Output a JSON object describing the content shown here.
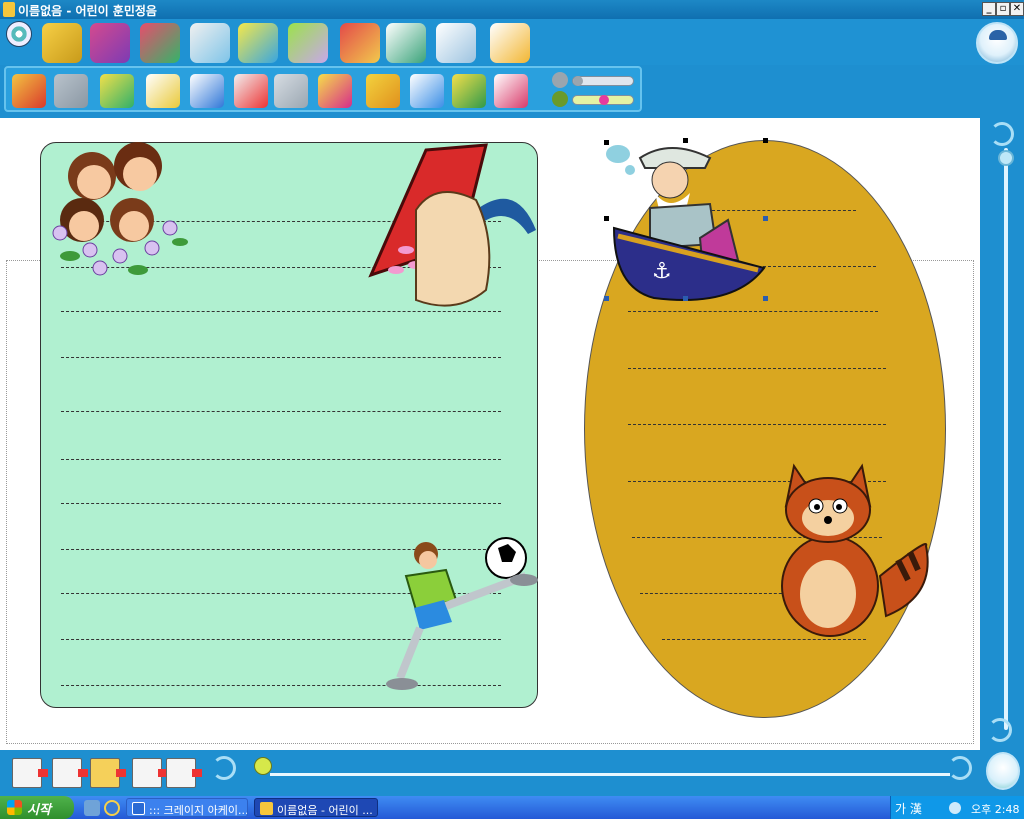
{
  "window": {
    "title": "이름없음 - 어린이 훈민정음",
    "minimize_label": "_",
    "restore_label": "▫",
    "close_label": "✕"
  },
  "main_toolbar": {
    "tools": [
      "toolbar-icon-cd",
      "toolbar-icon-folder",
      "toolbar-icon-house",
      "toolbar-icon-cube",
      "toolbar-icon-table",
      "toolbar-icon-paint",
      "toolbar-icon-stars",
      "toolbar-icon-cards",
      "toolbar-icon-book",
      "toolbar-icon-dog",
      "toolbar-icon-bird"
    ]
  },
  "sub_toolbar": {
    "tools": [
      "undo-icon",
      "redo-icon",
      "picture-frame-icon",
      "bee-icon",
      "picture-bird-icon",
      "insert-icon",
      "copy-icon",
      "align-left-icon",
      "align-center-icon",
      "front-back-icon",
      "group-icon",
      "layers-icon"
    ],
    "sliders": [
      {
        "name": "transparency-slider",
        "value": 0.0
      },
      {
        "name": "zoom-slider",
        "value": 0.55
      }
    ]
  },
  "document": {
    "green_card_lines": 11,
    "oval_card_lines": 9
  },
  "bottom": {
    "page_buttons": [
      "page-prev-button",
      "page-add-button",
      "page-copy-button",
      "page-next-button",
      "page-delete-button"
    ]
  },
  "taskbar": {
    "start_label": "시작",
    "tasks": [
      {
        "label": "::: 크레이지 아케이...",
        "active": false
      },
      {
        "label": "이름없음 - 어린이 ...",
        "active": true
      }
    ],
    "ime": "가 漢",
    "clock": "오후 2:48"
  },
  "colors": {
    "accent": "#1e8fd0",
    "green_card": "#b0f0d0",
    "oval_card": "#d9a720"
  }
}
